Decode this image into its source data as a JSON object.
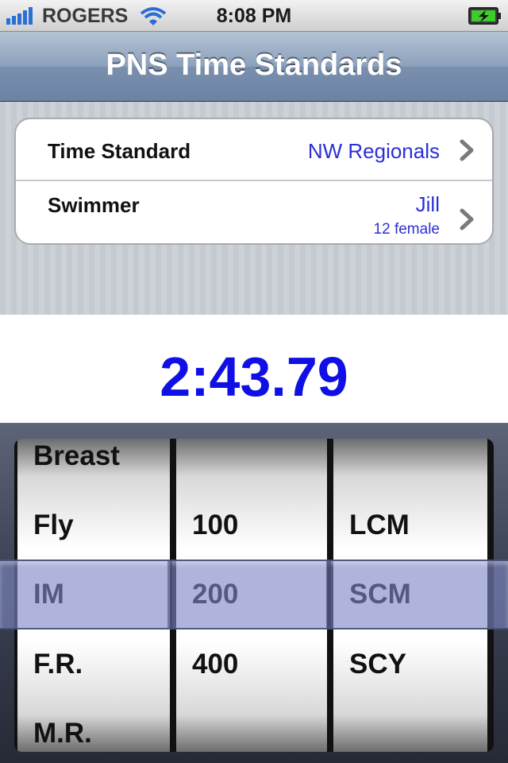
{
  "status_bar": {
    "carrier": "ROGERS",
    "time": "8:08 PM",
    "signal_icon": "signal-bars-icon",
    "wifi_icon": "wifi-icon",
    "battery_icon": "battery-charging-icon"
  },
  "nav": {
    "title": "PNS Time Standards"
  },
  "settings": {
    "time_standard": {
      "label": "Time Standard",
      "value": "NW Regionals"
    },
    "swimmer": {
      "label": "Swimmer",
      "value": "Jill",
      "detail": "12 female"
    }
  },
  "result": {
    "time": "2:43.79"
  },
  "picker": {
    "stroke": {
      "items": [
        "Breast",
        "Fly",
        "IM",
        "F.R.",
        "M.R."
      ],
      "selected": "IM"
    },
    "distance": {
      "items": [
        "100",
        "200",
        "400"
      ],
      "selected": "200"
    },
    "course": {
      "items": [
        "LCM",
        "SCM",
        "SCY"
      ],
      "selected": "SCM"
    }
  },
  "colors": {
    "accent_blue": "#2b2fd8",
    "time_blue": "#1010e6",
    "nav_bar": "#8ba0bc"
  }
}
